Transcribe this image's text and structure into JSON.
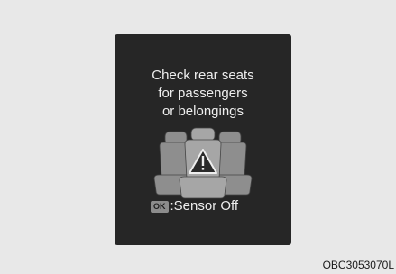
{
  "display": {
    "message_lines": [
      "Check rear seats",
      "for passengers",
      "or belongings"
    ],
    "ok_key_label": "OK",
    "ok_action_text": ":Sensor Off"
  },
  "image_code": "OBC3053070L",
  "icons": {
    "seats": "rear-seats-icon",
    "warning": "warning-triangle-icon"
  },
  "colors": {
    "screen": "#262626",
    "text": "#eeeeee",
    "seat": "#9a9a9a",
    "badge": "#8c8c8c",
    "background": "#e8e8e8"
  }
}
